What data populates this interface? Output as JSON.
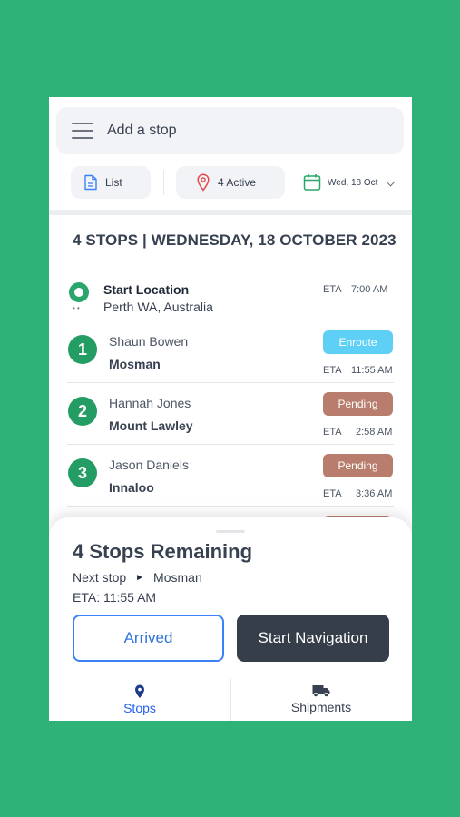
{
  "search": {
    "placeholder": "Add a stop"
  },
  "filters": {
    "list_label": "List",
    "active_label": "4 Active",
    "date_label": "Wed, 18 Oct"
  },
  "day_title": "4 STOPS | WEDNESDAY, 18 OCTOBER 2023",
  "start": {
    "title": "Start Location",
    "address": "Perth WA, Australia",
    "sub": "• •",
    "eta_label": "ETA",
    "eta": "7:00 AM"
  },
  "stops": [
    {
      "number": "1",
      "name": "Shaun Bowen",
      "suburb": "Mosman",
      "status": "Enroute",
      "eta_label": "ETA",
      "eta": "11:55 AM"
    },
    {
      "number": "2",
      "name": "Hannah Jones",
      "suburb": "Mount Lawley",
      "status": "Pending",
      "eta_label": "ETA",
      "eta": "2:58 AM"
    },
    {
      "number": "3",
      "name": "Jason Daniels",
      "suburb": "Innaloo",
      "status": "Pending",
      "eta_label": "ETA",
      "eta": "3:36 AM"
    }
  ],
  "sheet": {
    "title": "4 Stops Remaining",
    "next_label": "Next stop",
    "next_arrow": "►",
    "next_value": "Mosman",
    "eta_line": "ETA: 11:55 AM",
    "arrived_label": "Arrived",
    "navigation_label": "Start Navigation"
  },
  "tabs": [
    {
      "label": "Stops",
      "icon": "map-pin-icon"
    },
    {
      "label": "Shipments",
      "icon": "truck-icon"
    }
  ],
  "colors": {
    "background": "#2eb277",
    "stop_number": "#239d63",
    "enroute": "#5fd0f5",
    "pending": "#b87d6c",
    "primary_blue": "#3b82f6",
    "nav_button": "#363e4a"
  }
}
